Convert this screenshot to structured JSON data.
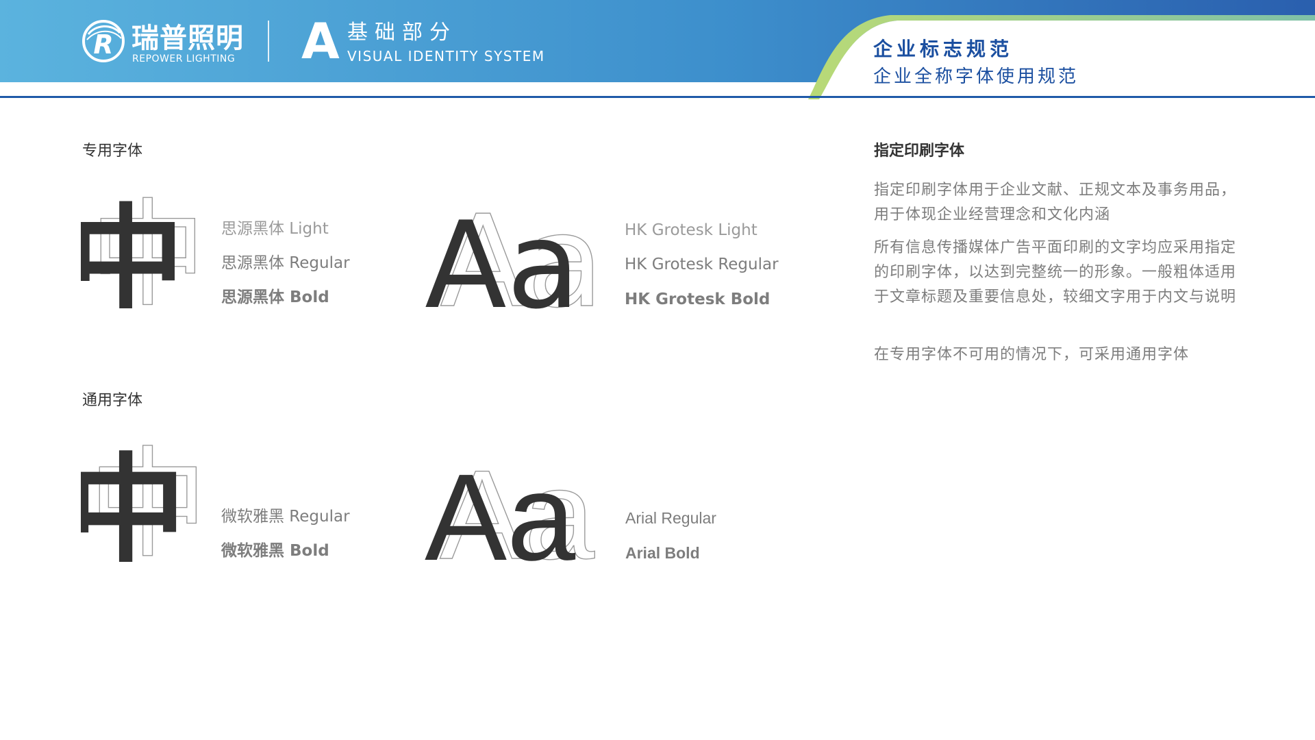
{
  "header": {
    "brand_cn": "瑞普照明",
    "brand_en": "REPOWER LIGHTING",
    "section_letter": "A",
    "section_cn": "基础部分",
    "section_en": "VISUAL IDENTITY SYSTEM",
    "nav_title": "企业标志规范",
    "nav_subtitle": "企业全称字体使用规范",
    "logo_letter": "R"
  },
  "colors": {
    "header_blue_start": "#5bb2dd",
    "header_blue_end": "#2f6fb6",
    "accent_green": "#a8d16b",
    "title_blue": "#1b4fa0",
    "rule_blue": "#1f5aa8",
    "text_dark": "#333333",
    "text_gray": "#7d7d7d"
  },
  "dedicated_fonts": {
    "label": "专用字体",
    "cn_glyph": "中",
    "en_glyph": "Aa",
    "cn_fonts": [
      "思源黑体 Light",
      "思源黑体 Regular",
      "思源黑体 Bold"
    ],
    "en_fonts": [
      "HK Grotesk Light",
      "HK Grotesk Regular",
      "HK Grotesk Bold"
    ]
  },
  "general_fonts": {
    "label": "通用字体",
    "cn_glyph": "中",
    "en_glyph": "Aa",
    "cn_fonts": [
      "微软雅黑 Regular",
      "微软雅黑 Bold"
    ],
    "en_fonts": [
      "Arial Regular",
      "Arial Bold"
    ]
  },
  "description": {
    "title": "指定印刷字体",
    "paragraphs": [
      "指定印刷字体用于企业文献、正规文本及事务用品，用于体现企业经营理念和文化内涵",
      "所有信息传播媒体广告平面印刷的文字均应采用指定的印刷字体，以达到完整统一的形象。一般粗体适用于文章标题及重要信息处，较细文字用于内文与说明",
      "在专用字体不可用的情况下，可采用通用字体"
    ]
  }
}
